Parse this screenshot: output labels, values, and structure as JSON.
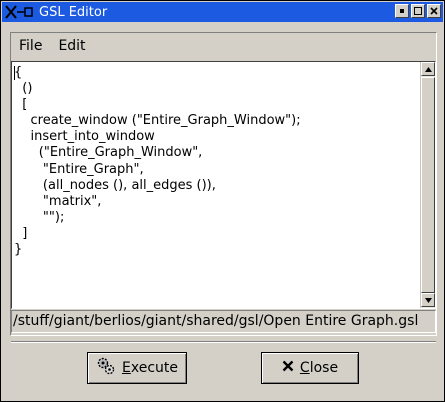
{
  "window": {
    "title": "GSL Editor"
  },
  "menu": {
    "file": "File",
    "edit": "Edit"
  },
  "editor": {
    "code": "{\n  ()\n  [\n    create_window (\"Entire_Graph_Window\");\n    insert_into_window\n      (\"Entire_Graph_Window\",\n       \"Entire_Graph\",\n       (all_nodes (), all_edges ()),\n       \"matrix\",\n       \"\");\n  ]\n}"
  },
  "path": {
    "text": "/stuff/giant/berlios/giant/shared/gsl/Open Entire Graph.gsl"
  },
  "buttons": {
    "execute": {
      "mnemonic": "E",
      "rest": "xecute",
      "icon": "gears-icon"
    },
    "close": {
      "mnemonic": "C",
      "rest": "lose",
      "icon": "x-icon"
    }
  }
}
